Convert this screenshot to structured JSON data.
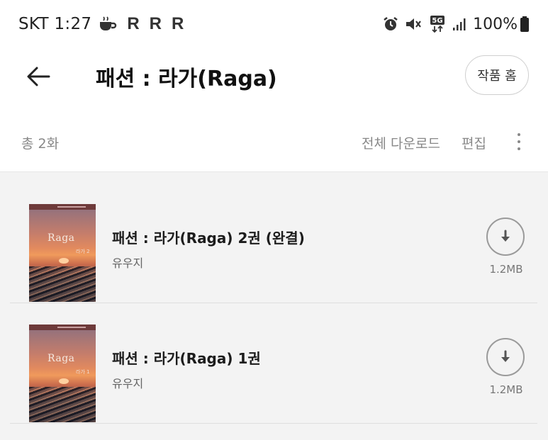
{
  "status_bar": {
    "carrier_time": "SKT 1:27",
    "icons_left": [
      "coffee-icon",
      "r-icon",
      "r-icon",
      "r-icon"
    ],
    "r_label": "R",
    "icons_right": [
      "alarm-icon",
      "mute-icon",
      "5g-icon",
      "signal-icon",
      "battery-icon"
    ],
    "battery": "100%"
  },
  "app_bar": {
    "title": "패션 : 라가(Raga)",
    "work_home_label": "작품 홈"
  },
  "sub_header": {
    "total": "총 2화",
    "download_all": "전체 다운로드",
    "edit": "편집"
  },
  "items": [
    {
      "title": "패션 : 라가(Raga) 2권 (완결)",
      "author": "유우지",
      "size": "1.2MB",
      "cover_text": "Raga",
      "cover_vol": "라가 2"
    },
    {
      "title": "패션 : 라가(Raga) 1권",
      "author": "유우지",
      "size": "1.2MB",
      "cover_text": "Raga",
      "cover_vol": "라가 1"
    }
  ],
  "colors": {
    "list_background": "#f3f3f3",
    "text_primary": "#1c1c1c",
    "text_secondary": "#888888"
  }
}
